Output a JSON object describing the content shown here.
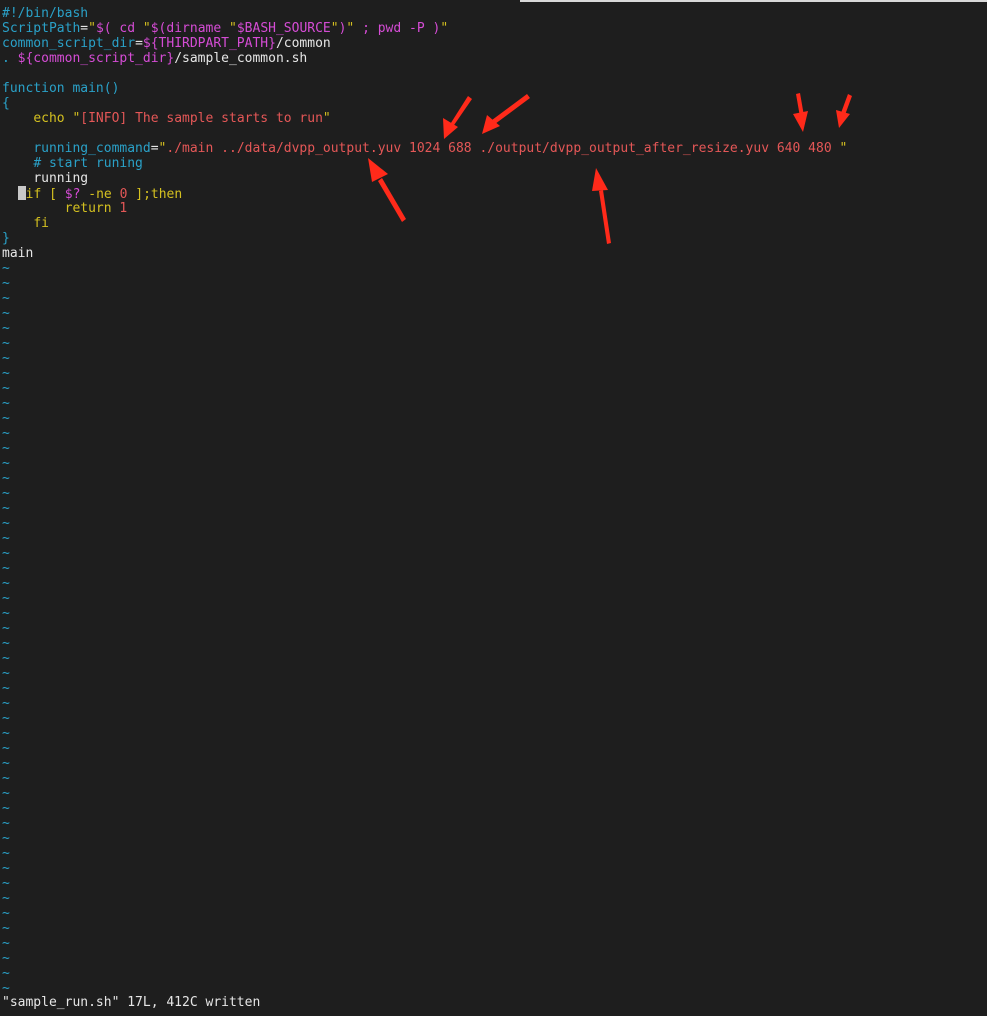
{
  "editor": {
    "l1": "#!/bin/bash",
    "l2": {
      "var": "ScriptPath",
      "eq": "=",
      "q1": "\"",
      "a": "$( cd ",
      "q2": "\"",
      "b": "$(dirname ",
      "q3": "\"",
      "c": "$BASH_SOURCE",
      "q4": "\"",
      "d": ")",
      "q5": "\"",
      "e": " ; pwd -P )",
      "q6": "\""
    },
    "l3": {
      "var": "common_script_dir",
      "eq": "=",
      "expr": "${THIRDPART_PATH}",
      "rest": "/common"
    },
    "l4": {
      "dot": ". ",
      "expr": "${common_script_dir}",
      "rest": "/sample_common.sh"
    },
    "l5": "",
    "l6": "function main()",
    "l7": "{",
    "l8": {
      "indent": "    ",
      "kw": "echo ",
      "q1": "\"",
      "str": "[INFO] The sample starts to run",
      "q2": "\""
    },
    "l9": "",
    "l10": {
      "indent": "    ",
      "var": "running_command",
      "eq": "=",
      "q1": "\"",
      "str": "./main ../data/dvpp_output.yuv 1024 688 ./output/dvpp_output_after_resize.yuv 640 480 ",
      "q2": "\""
    },
    "l11": {
      "indent": "    ",
      "comment": "# start runing"
    },
    "l12": {
      "indent": "    ",
      "text": "running"
    },
    "l13": {
      "kw": "if [ ",
      "purple": "$?",
      "rest1": " -ne ",
      "num": "0",
      "rest2": " ];then"
    },
    "l14": {
      "indent": "        ",
      "kw": "return ",
      "num": "1"
    },
    "l15": {
      "indent": "    ",
      "kw": "fi"
    },
    "l16": "}",
    "l17": "main",
    "tilde": "~"
  },
  "status_line": "\"sample_run.sh\" 17L, 412C written",
  "colors": {
    "background": "#1e1e1e",
    "annotation_arrow": "#ff2a1a"
  }
}
